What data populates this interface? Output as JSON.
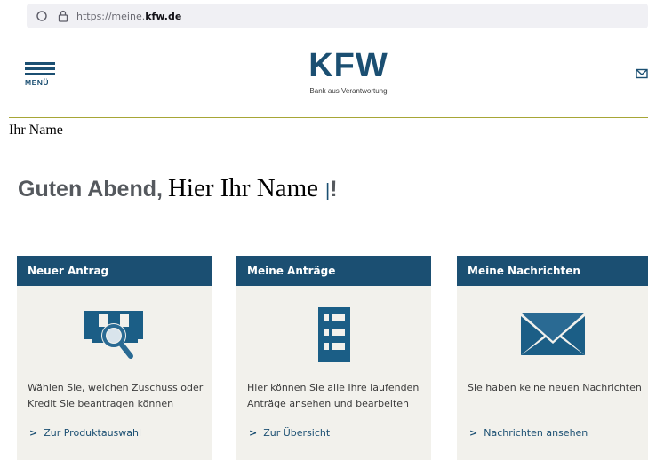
{
  "browser": {
    "url_prefix": "https://meine.",
    "url_domain": "kfw.de",
    "icons": [
      "shield-icon",
      "lock-icon"
    ]
  },
  "header": {
    "menu_label": "MENÜ",
    "logo_text": "KFW",
    "logo_tagline": "Bank aus Verantwortung",
    "icons": [
      "hamburger-icon",
      "mail-icon"
    ]
  },
  "name_label": "Ihr Name",
  "greeting": {
    "prefix": "Guten Abend,",
    "name_placeholder": "Hier Ihr Name",
    "cursor": "|",
    "suffix": "!"
  },
  "cards": [
    {
      "title": "Neuer Antrag",
      "icon": "document-search-icon",
      "text": "Wählen Sie, welchen Zuschuss oder Kredit Sie beantragen können",
      "link": "Zur Produktauswahl"
    },
    {
      "title": "Meine Anträge",
      "icon": "list-icon",
      "text": "Hier können Sie alle Ihre laufenden Anträge ansehen und bearbeiten",
      "link": "Zur Übersicht"
    },
    {
      "title": "Meine Nachrichten",
      "icon": "envelope-icon",
      "text": "Sie haben keine neuen Nachrichten",
      "link": "Nachrichten ansehen"
    }
  ],
  "link_chevron": ">",
  "colors": {
    "brand": "#1b4f72",
    "card_background": "#f2f1ec",
    "icon_blue": "#1b5e86",
    "rule": "#a7a636",
    "greeting_gray": "#55595e"
  }
}
